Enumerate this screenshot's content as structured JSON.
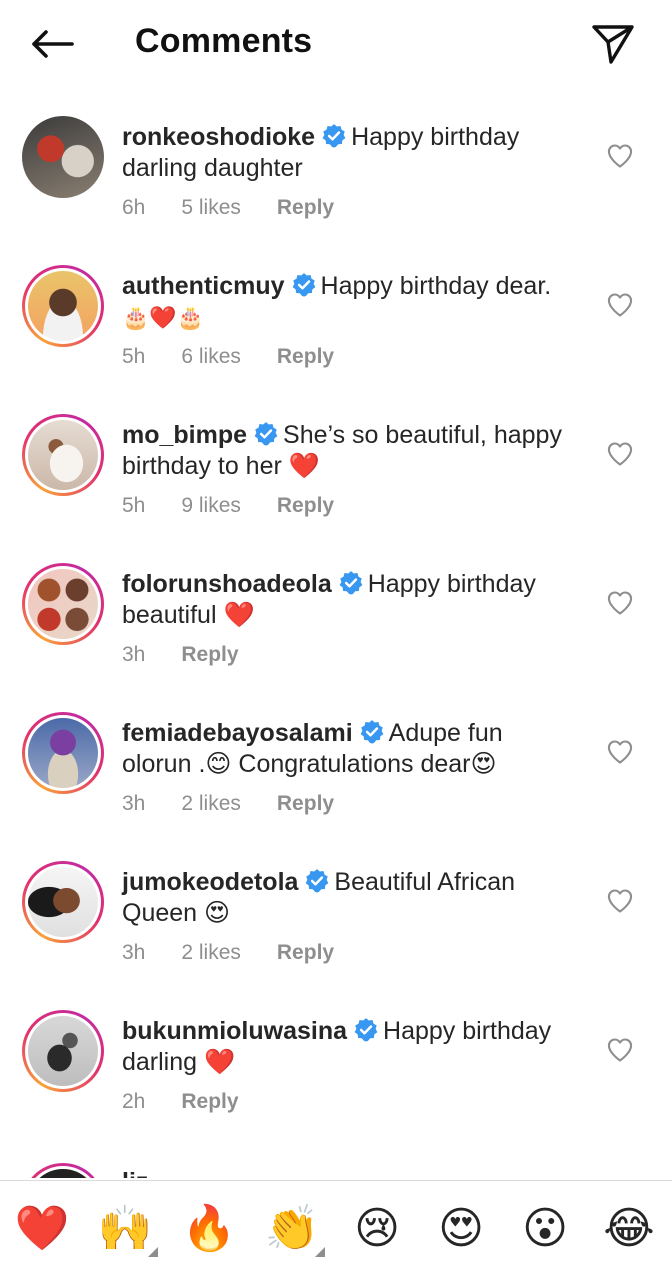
{
  "header": {
    "title": "Comments"
  },
  "comments": [
    {
      "username": "ronkeoshodioke",
      "text_line1": "Happy birthday",
      "text_line2": "darling daughter",
      "time": "6h",
      "likes": "5 likes",
      "reply": "Reply",
      "ring": false
    },
    {
      "username": "authenticmuy",
      "text_line1": "Happy birthday dear.",
      "text_line2": "🎂❤️🎂",
      "time": "5h",
      "likes": "6 likes",
      "reply": "Reply",
      "ring": true
    },
    {
      "username": "mo_bimpe",
      "text_line1": "She’s so beautiful, happy",
      "text_line2": "birthday to her ❤️",
      "time": "5h",
      "likes": "9 likes",
      "reply": "Reply",
      "ring": true
    },
    {
      "username": "folorunshoadeola",
      "text_line1": "Happy birthday",
      "text_line2": "beautiful ❤️",
      "time": "3h",
      "likes": "",
      "reply": "Reply",
      "ring": true
    },
    {
      "username": "femiadebayosalami",
      "text_line1": "Adupe fun",
      "text_line2": "olorun .😊 Congratulations dear😍",
      "time": "3h",
      "likes": "2 likes",
      "reply": "Reply",
      "ring": true
    },
    {
      "username": "jumokeodetola",
      "text_line1": "Beautiful African",
      "text_line2": "Queen 😍",
      "time": "3h",
      "likes": "2 likes",
      "reply": "Reply",
      "ring": true
    },
    {
      "username": "bukunmioluwasina",
      "text_line1": "Happy birthday",
      "text_line2": "darling ❤️",
      "time": "2h",
      "likes": "",
      "reply": "Reply",
      "ring": true
    }
  ],
  "partial_comment": {
    "username": "liz..."
  },
  "emoji_bar": [
    {
      "emoji": "❤️",
      "name": "heart",
      "has_more": false
    },
    {
      "emoji": "🙌",
      "name": "raising-hands",
      "has_more": true
    },
    {
      "emoji": "🔥",
      "name": "fire",
      "has_more": false
    },
    {
      "emoji": "👏",
      "name": "clapping-hands",
      "has_more": true
    },
    {
      "emoji": "😢",
      "name": "crying-face",
      "has_more": false
    },
    {
      "emoji": "😍",
      "name": "heart-eyes",
      "has_more": false
    },
    {
      "emoji": "😮",
      "name": "surprised-face",
      "has_more": false
    },
    {
      "emoji": "😂",
      "name": "tears-of-joy",
      "has_more": false
    }
  ],
  "colors": {
    "verified": "#3897f0",
    "meta_text": "#8e8e8e",
    "text": "#262626"
  }
}
